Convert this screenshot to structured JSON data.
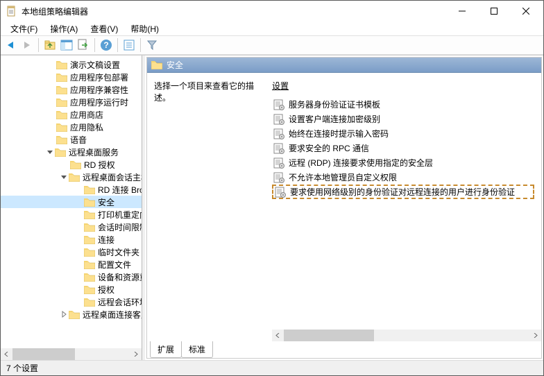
{
  "window": {
    "title": "本地组策略编辑器"
  },
  "menu": {
    "file": "文件(F)",
    "action": "操作(A)",
    "view": "查看(V)",
    "help": "帮助(H)"
  },
  "tree": {
    "items": [
      {
        "label": "演示文稿设置",
        "indent": 80
      },
      {
        "label": "应用程序包部署",
        "indent": 80
      },
      {
        "label": "应用程序兼容性",
        "indent": 80
      },
      {
        "label": "应用程序运行时",
        "indent": 80
      },
      {
        "label": "应用商店",
        "indent": 80
      },
      {
        "label": "应用隐私",
        "indent": 80
      },
      {
        "label": "语音",
        "indent": 80
      },
      {
        "label": "远程桌面服务",
        "indent": 80,
        "expander": "down",
        "expIndent": 64
      },
      {
        "label": "RD 授权",
        "indent": 100
      },
      {
        "label": "远程桌面会话主机",
        "indent": 100,
        "expander": "down",
        "expIndent": 84
      },
      {
        "label": "RD 连接 Broker",
        "indent": 120
      },
      {
        "label": "安全",
        "indent": 120,
        "selected": true
      },
      {
        "label": "打印机重定向",
        "indent": 120
      },
      {
        "label": "会话时间限制",
        "indent": 120
      },
      {
        "label": "连接",
        "indent": 120
      },
      {
        "label": "临时文件夹",
        "indent": 120
      },
      {
        "label": "配置文件",
        "indent": 120
      },
      {
        "label": "设备和资源重定向",
        "indent": 120
      },
      {
        "label": "授权",
        "indent": 120
      },
      {
        "label": "远程会话环境",
        "indent": 120
      },
      {
        "label": "远程桌面连接客户端",
        "indent": 100,
        "expander": "right",
        "expIndent": 84
      }
    ]
  },
  "right": {
    "header": "安全",
    "desc": "选择一个项目来查看它的描述。",
    "listHeader": "设置",
    "items": [
      {
        "label": "服务器身份验证证书模板"
      },
      {
        "label": "设置客户端连接加密级别"
      },
      {
        "label": "始终在连接时提示输入密码"
      },
      {
        "label": "要求安全的 RPC 通信"
      },
      {
        "label": "远程 (RDP) 连接要求使用指定的安全层"
      },
      {
        "label": "不允许本地管理员自定义权限"
      },
      {
        "label": "要求使用网络级别的身份验证对远程连接的用户进行身份验证",
        "highlighted": true
      }
    ]
  },
  "tabs": {
    "extended": "扩展",
    "standard": "标准"
  },
  "status": {
    "text": "7 个设置"
  }
}
